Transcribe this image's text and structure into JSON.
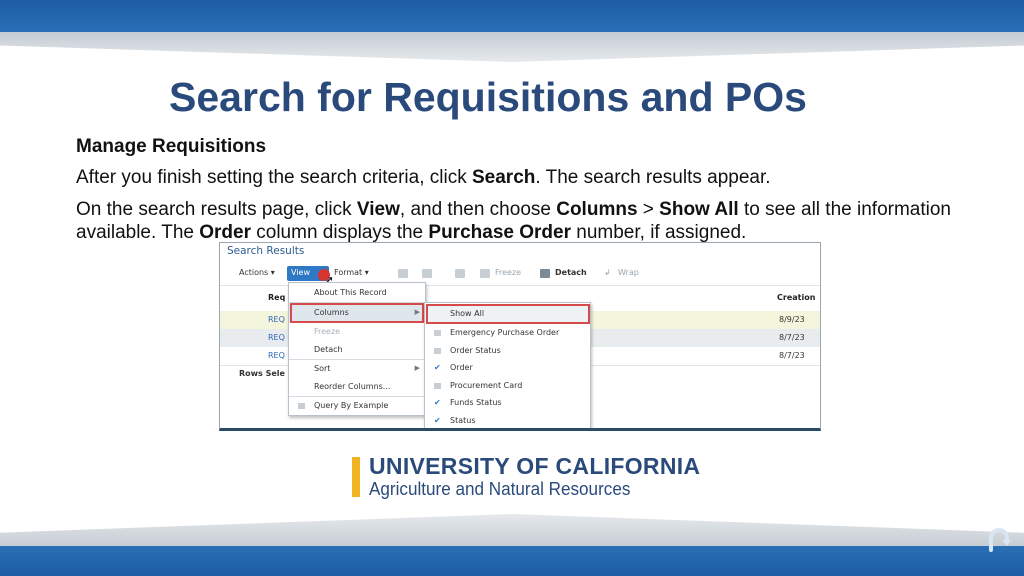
{
  "slide": {
    "title": "Search for Requisitions and POs",
    "subheading": "Manage Requisitions",
    "para1": {
      "pre": "After you finish setting the search criteria, click ",
      "bold": "Search",
      "post": ". The search results appear."
    },
    "para2": {
      "t1": "On the search results page, click ",
      "b1": "View",
      "t2": ", and then choose ",
      "b2": "Columns",
      "t3": " > ",
      "b3": "Show All",
      "t4": " to see all the information available. The ",
      "b4": "Order",
      "t5": " column displays the ",
      "b5": "Purchase Order",
      "t6": " number, if assigned."
    }
  },
  "screenshot": {
    "title": "Search Results",
    "toolbar": {
      "actions": "Actions",
      "view": "View",
      "format": "Format",
      "freeze": "Freeze",
      "detach": "Detach",
      "wrap": "Wrap"
    },
    "headers": {
      "requisition": "Req",
      "creation": "Creation"
    },
    "rows": [
      {
        "link": "REQ",
        "date": "8/9/23"
      },
      {
        "link": "REQ",
        "date": "8/7/23"
      },
      {
        "link": "REQ",
        "date": "8/7/23"
      }
    ],
    "rows_selected": "Rows Sele",
    "view_menu": {
      "about": "About This Record",
      "columns": "Columns",
      "freeze": "Freeze",
      "detach": "Detach",
      "sort": "Sort",
      "reorder": "Reorder Columns...",
      "query": "Query By Example"
    },
    "columns_menu": {
      "show_all": "Show All",
      "emergency": "Emergency Purchase Order",
      "order_status": "Order Status",
      "order": "Order",
      "procurement": "Procurement Card",
      "funds": "Funds Status",
      "status": "Status"
    }
  },
  "logo": {
    "line1": "UNIVERSITY OF CALIFORNIA",
    "line2": "Agriculture and Natural Resources"
  },
  "colors": {
    "brand_blue": "#2b4a7c",
    "band_blue": "#1d5da3",
    "logo_gold": "#f2b321",
    "highlight_red": "#d54a4a"
  }
}
